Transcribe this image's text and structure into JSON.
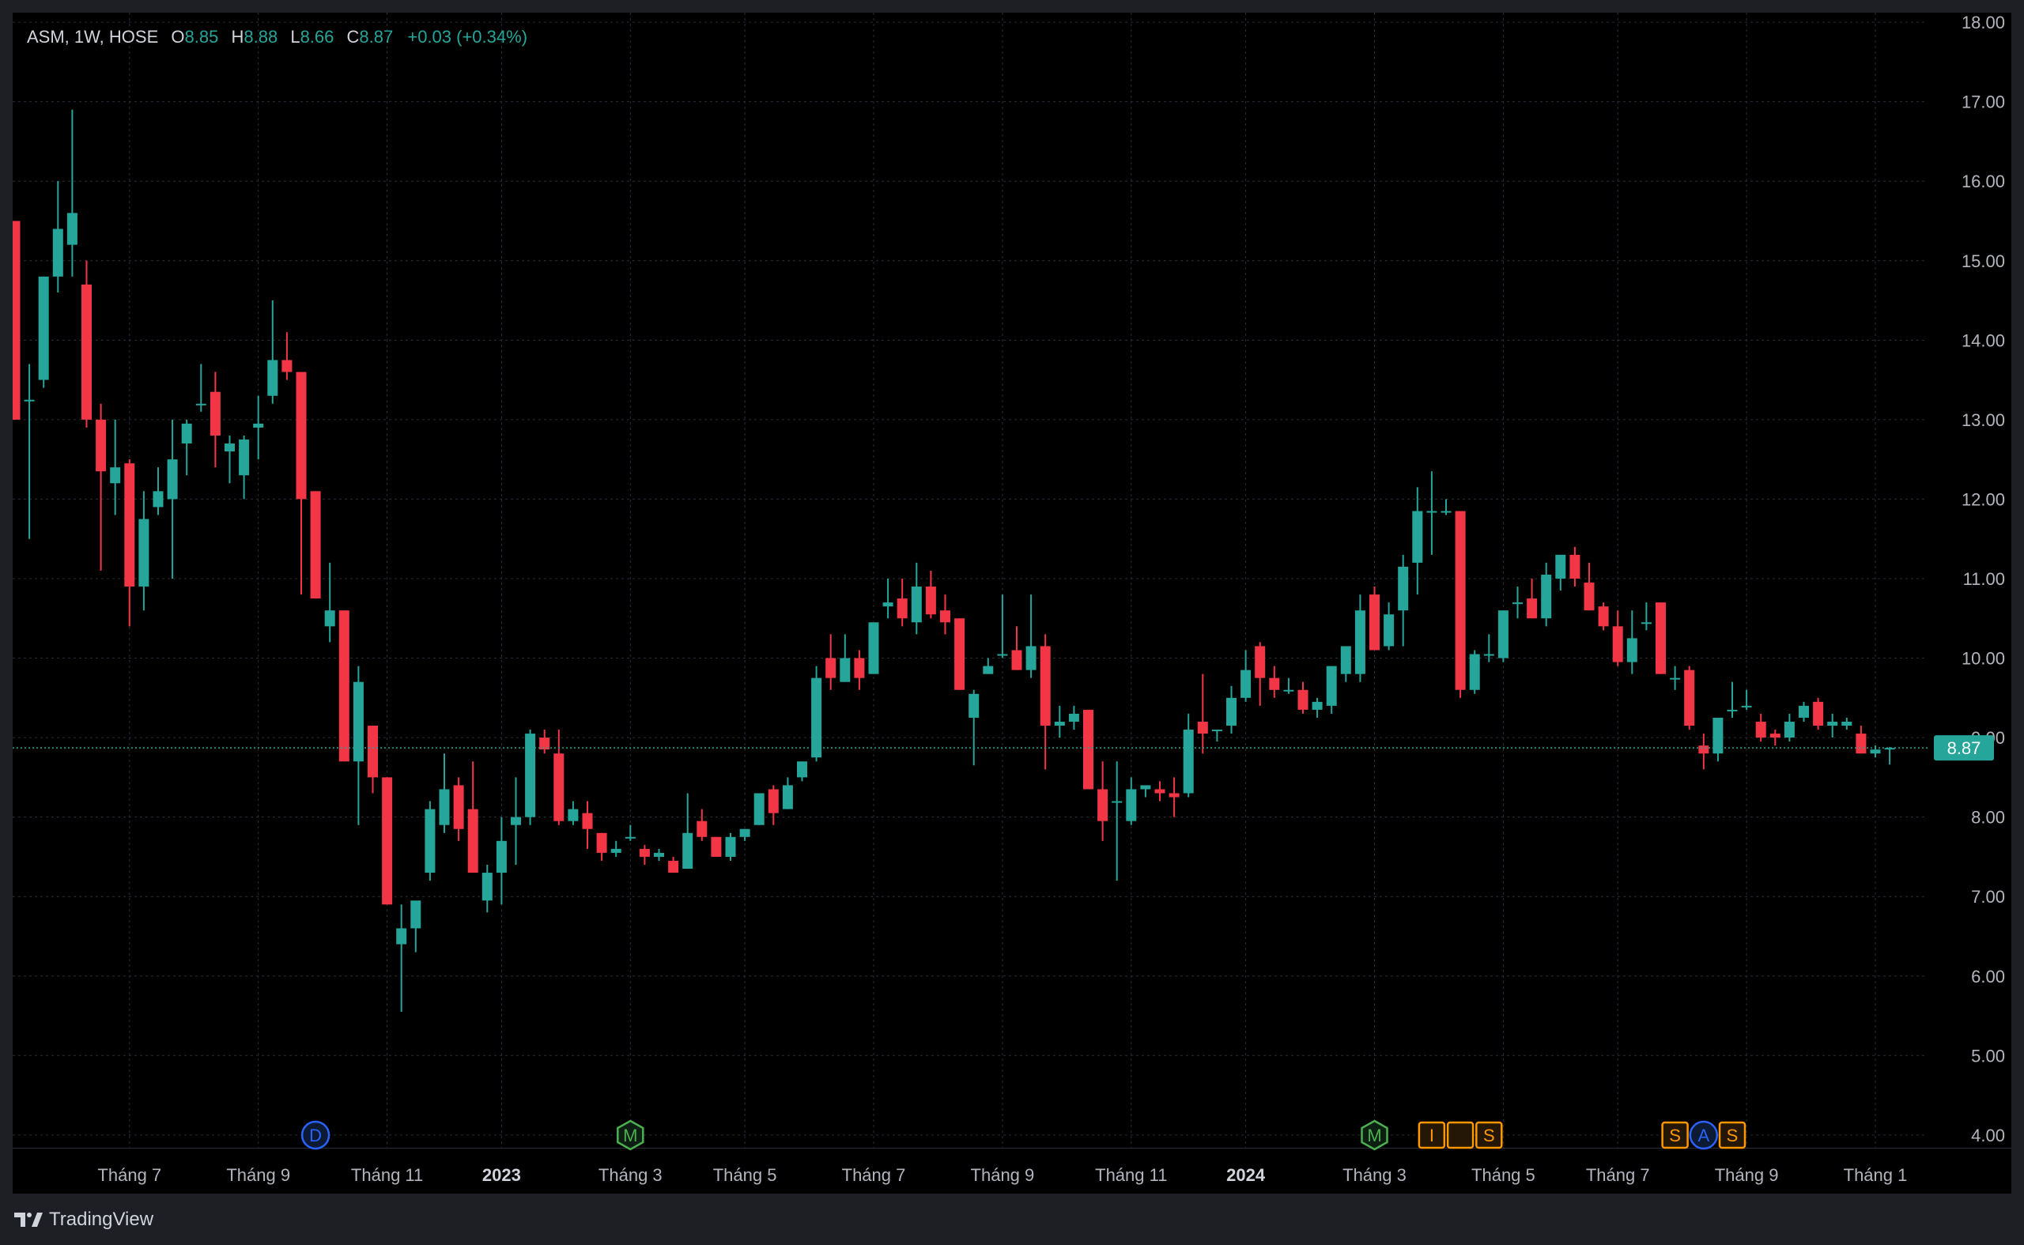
{
  "legend": {
    "symbol": "ASM, 1W, HOSE",
    "open_label": "O",
    "open": "8.85",
    "high_label": "H",
    "high": "8.88",
    "low_label": "L",
    "low": "8.66",
    "close_label": "C",
    "close": "8.87",
    "change": "+0.03 (+0.34%)"
  },
  "last_price_tag": "8.87",
  "brand": {
    "name": "TradingView",
    "icon": "tradingview-logo-icon"
  },
  "colors": {
    "up": "#26a69a",
    "down": "#f23645",
    "background": "#000000",
    "grid": "#2a2e39",
    "axis_text": "#b2b5be",
    "price_line": "#26a69a",
    "event_dividend": "#2962ff",
    "event_meeting": "#4caf50",
    "event_other": "#ff9800"
  },
  "chart_data": {
    "type": "candlestick",
    "interval": "1W",
    "symbol": "ASM",
    "exchange": "HOSE",
    "ylim": [
      3.75,
      18.2
    ],
    "y_ticks": [
      "4.00",
      "5.00",
      "6.00",
      "7.00",
      "8.00",
      "9.00",
      "10.00",
      "11.00",
      "12.00",
      "13.00",
      "14.00",
      "15.00",
      "16.00",
      "17.00",
      "18.00"
    ],
    "x_ticks": [
      {
        "label": "Tháng 7",
        "bar": 8,
        "bold": false
      },
      {
        "label": "Tháng 9",
        "bar": 17,
        "bold": false
      },
      {
        "label": "Tháng 11",
        "bar": 26,
        "bold": false
      },
      {
        "label": "2023",
        "bar": 34,
        "bold": true
      },
      {
        "label": "Tháng 3",
        "bar": 43,
        "bold": false
      },
      {
        "label": "Tháng 5",
        "bar": 51,
        "bold": false
      },
      {
        "label": "Tháng 7",
        "bar": 60,
        "bold": false
      },
      {
        "label": "Tháng 9",
        "bar": 69,
        "bold": false
      },
      {
        "label": "Tháng 11",
        "bar": 78,
        "bold": false
      },
      {
        "label": "2024",
        "bar": 86,
        "bold": true
      },
      {
        "label": "Tháng 3",
        "bar": 95,
        "bold": false
      },
      {
        "label": "Tháng 5",
        "bar": 104,
        "bold": false
      },
      {
        "label": "Tháng 7",
        "bar": 112,
        "bold": false
      },
      {
        "label": "Tháng 9",
        "bar": 121,
        "bold": false
      },
      {
        "label": "Tháng 1",
        "bar": 130,
        "bold": false
      }
    ],
    "ohlc": [
      [
        15.5,
        15.5,
        13.0,
        13.0
      ],
      [
        13.25,
        13.7,
        11.5,
        13.25
      ],
      [
        13.5,
        14.8,
        13.4,
        14.8
      ],
      [
        14.8,
        16.0,
        14.6,
        15.4
      ],
      [
        15.2,
        16.9,
        14.8,
        15.6
      ],
      [
        14.7,
        15.0,
        12.9,
        13.0
      ],
      [
        13.0,
        13.2,
        11.1,
        12.35
      ],
      [
        12.2,
        13.0,
        11.8,
        12.4
      ],
      [
        12.45,
        12.5,
        10.4,
        10.9
      ],
      [
        10.9,
        12.1,
        10.6,
        11.75
      ],
      [
        11.9,
        12.4,
        11.8,
        12.1
      ],
      [
        12.0,
        13.0,
        11.0,
        12.5
      ],
      [
        12.7,
        13.0,
        12.3,
        12.95
      ],
      [
        13.2,
        13.7,
        13.1,
        13.2
      ],
      [
        13.35,
        13.6,
        12.4,
        12.8
      ],
      [
        12.6,
        12.8,
        12.2,
        12.7
      ],
      [
        12.3,
        12.8,
        12.0,
        12.75
      ],
      [
        12.9,
        13.3,
        12.5,
        12.95
      ],
      [
        13.3,
        14.5,
        13.2,
        13.75
      ],
      [
        13.75,
        14.1,
        13.5,
        13.6
      ],
      [
        13.6,
        13.6,
        10.8,
        12.0
      ],
      [
        12.1,
        12.1,
        10.75,
        10.75
      ],
      [
        10.4,
        11.2,
        10.2,
        10.6
      ],
      [
        10.6,
        10.6,
        8.7,
        8.7
      ],
      [
        8.7,
        9.9,
        7.9,
        9.7
      ],
      [
        9.15,
        9.15,
        8.3,
        8.5
      ],
      [
        8.5,
        8.5,
        6.9,
        6.9
      ],
      [
        6.4,
        6.9,
        5.55,
        6.6
      ],
      [
        6.6,
        6.9,
        6.3,
        6.95
      ],
      [
        7.3,
        8.2,
        7.2,
        8.1
      ],
      [
        7.9,
        8.8,
        7.8,
        8.35
      ],
      [
        8.4,
        8.5,
        7.7,
        7.85
      ],
      [
        8.1,
        8.7,
        7.5,
        7.3
      ],
      [
        6.95,
        7.4,
        6.8,
        7.3
      ],
      [
        7.3,
        8.0,
        6.9,
        7.7
      ],
      [
        7.9,
        8.5,
        7.4,
        8.0
      ],
      [
        8.0,
        9.1,
        7.9,
        9.05
      ],
      [
        9.0,
        9.1,
        8.8,
        8.85
      ],
      [
        8.8,
        9.1,
        7.9,
        7.95
      ],
      [
        7.95,
        8.2,
        7.9,
        8.1
      ],
      [
        8.05,
        8.2,
        7.6,
        7.85
      ],
      [
        7.8,
        7.8,
        7.45,
        7.55
      ],
      [
        7.55,
        7.7,
        7.5,
        7.6
      ],
      [
        7.75,
        7.9,
        7.7,
        7.75
      ],
      [
        7.6,
        7.65,
        7.4,
        7.5
      ],
      [
        7.5,
        7.6,
        7.45,
        7.55
      ],
      [
        7.45,
        7.5,
        7.3,
        7.3
      ],
      [
        7.35,
        8.3,
        7.35,
        7.8
      ],
      [
        7.95,
        8.1,
        7.7,
        7.75
      ],
      [
        7.75,
        7.75,
        7.5,
        7.5
      ],
      [
        7.5,
        7.8,
        7.45,
        7.75
      ],
      [
        7.75,
        7.85,
        7.7,
        7.85
      ],
      [
        7.9,
        8.3,
        7.9,
        8.3
      ],
      [
        8.35,
        8.4,
        7.9,
        8.05
      ],
      [
        8.1,
        8.5,
        8.1,
        8.4
      ],
      [
        8.5,
        8.7,
        8.45,
        8.7
      ],
      [
        8.75,
        9.9,
        8.7,
        9.75
      ],
      [
        10.0,
        10.3,
        9.6,
        9.75
      ],
      [
        9.7,
        10.3,
        9.7,
        10.0
      ],
      [
        10.0,
        10.1,
        9.6,
        9.75
      ],
      [
        9.8,
        10.4,
        9.8,
        10.45
      ],
      [
        10.65,
        11.0,
        10.5,
        10.7
      ],
      [
        10.75,
        11.0,
        10.4,
        10.5
      ],
      [
        10.45,
        11.2,
        10.3,
        10.9
      ],
      [
        10.9,
        11.1,
        10.5,
        10.55
      ],
      [
        10.6,
        10.8,
        10.3,
        10.45
      ],
      [
        10.5,
        10.5,
        9.6,
        9.6
      ],
      [
        9.25,
        9.6,
        8.65,
        9.55
      ],
      [
        9.8,
        10.0,
        9.8,
        9.9
      ],
      [
        10.05,
        10.8,
        10.0,
        10.05
      ],
      [
        10.1,
        10.4,
        9.85,
        9.85
      ],
      [
        9.85,
        10.8,
        9.75,
        10.15
      ],
      [
        10.15,
        10.3,
        8.6,
        9.15
      ],
      [
        9.15,
        9.4,
        9.0,
        9.2
      ],
      [
        9.2,
        9.4,
        9.1,
        9.3
      ],
      [
        9.35,
        9.35,
        8.35,
        8.35
      ],
      [
        8.35,
        8.7,
        7.7,
        7.95
      ],
      [
        8.2,
        8.7,
        7.2,
        8.2
      ],
      [
        7.95,
        8.5,
        7.9,
        8.35
      ],
      [
        8.35,
        8.4,
        8.25,
        8.4
      ],
      [
        8.35,
        8.45,
        8.2,
        8.3
      ],
      [
        8.3,
        8.5,
        8.0,
        8.25
      ],
      [
        8.3,
        9.3,
        8.25,
        9.1
      ],
      [
        9.2,
        9.8,
        8.8,
        9.05
      ],
      [
        9.1,
        9.1,
        8.95,
        9.1
      ],
      [
        9.15,
        9.65,
        9.05,
        9.5
      ],
      [
        9.5,
        10.1,
        9.45,
        9.85
      ],
      [
        10.15,
        10.2,
        9.4,
        9.75
      ],
      [
        9.75,
        9.9,
        9.5,
        9.6
      ],
      [
        9.6,
        9.75,
        9.55,
        9.6
      ],
      [
        9.6,
        9.7,
        9.3,
        9.35
      ],
      [
        9.35,
        9.5,
        9.25,
        9.45
      ],
      [
        9.4,
        9.9,
        9.3,
        9.9
      ],
      [
        9.8,
        10.0,
        9.7,
        10.15
      ],
      [
        9.8,
        10.8,
        9.7,
        10.6
      ],
      [
        10.8,
        10.9,
        10.2,
        10.1
      ],
      [
        10.15,
        10.7,
        10.1,
        10.55
      ],
      [
        10.6,
        11.3,
        10.15,
        11.15
      ],
      [
        11.2,
        12.15,
        10.8,
        11.85
      ],
      [
        11.85,
        12.35,
        11.3,
        11.85
      ],
      [
        11.85,
        12.0,
        11.8,
        11.85
      ],
      [
        11.85,
        11.85,
        9.5,
        9.6
      ],
      [
        9.6,
        10.1,
        9.55,
        10.05
      ],
      [
        10.05,
        10.3,
        9.95,
        10.05
      ],
      [
        10.0,
        10.6,
        9.95,
        10.6
      ],
      [
        10.7,
        10.9,
        10.5,
        10.7
      ],
      [
        10.75,
        11.0,
        10.5,
        10.5
      ],
      [
        10.5,
        11.2,
        10.4,
        11.05
      ],
      [
        11.0,
        11.3,
        10.85,
        11.3
      ],
      [
        11.3,
        11.4,
        10.9,
        11.0
      ],
      [
        10.95,
        11.2,
        10.6,
        10.6
      ],
      [
        10.65,
        10.7,
        10.35,
        10.4
      ],
      [
        10.4,
        10.6,
        9.9,
        9.95
      ],
      [
        9.95,
        10.6,
        9.8,
        10.25
      ],
      [
        10.45,
        10.7,
        10.35,
        10.45
      ],
      [
        10.7,
        10.7,
        9.8,
        9.8
      ],
      [
        9.75,
        9.9,
        9.6,
        9.75
      ],
      [
        9.85,
        9.9,
        9.1,
        9.15
      ],
      [
        8.9,
        9.05,
        8.6,
        8.8
      ],
      [
        8.8,
        9.2,
        8.7,
        9.25
      ],
      [
        9.35,
        9.7,
        9.25,
        9.35
      ],
      [
        9.4,
        9.6,
        9.35,
        9.4
      ],
      [
        9.2,
        9.3,
        8.95,
        9.0
      ],
      [
        9.05,
        9.1,
        8.9,
        9.0
      ],
      [
        9.0,
        9.3,
        8.95,
        9.2
      ],
      [
        9.25,
        9.45,
        9.2,
        9.4
      ],
      [
        9.45,
        9.5,
        9.1,
        9.15
      ],
      [
        9.15,
        9.3,
        9.0,
        9.2
      ],
      [
        9.15,
        9.25,
        9.1,
        9.2
      ],
      [
        9.05,
        9.15,
        8.8,
        8.8
      ],
      [
        8.8,
        8.9,
        8.75,
        8.85
      ],
      [
        8.85,
        8.88,
        8.66,
        8.87
      ]
    ],
    "events": [
      {
        "label": "D",
        "bar": 21,
        "kind": "dividend"
      },
      {
        "label": "M",
        "bar": 43,
        "kind": "meeting"
      },
      {
        "label": "M",
        "bar": 95,
        "kind": "meeting"
      },
      {
        "label": "I",
        "bar": 99,
        "kind": "other"
      },
      {
        "label": "",
        "bar": 101,
        "kind": "other"
      },
      {
        "label": "S",
        "bar": 103,
        "kind": "other"
      },
      {
        "label": "S",
        "bar": 116,
        "kind": "other"
      },
      {
        "label": "A",
        "bar": 118,
        "kind": "dividend"
      },
      {
        "label": "S",
        "bar": 120,
        "kind": "other"
      }
    ],
    "last_price": 8.87,
    "grid": true
  }
}
